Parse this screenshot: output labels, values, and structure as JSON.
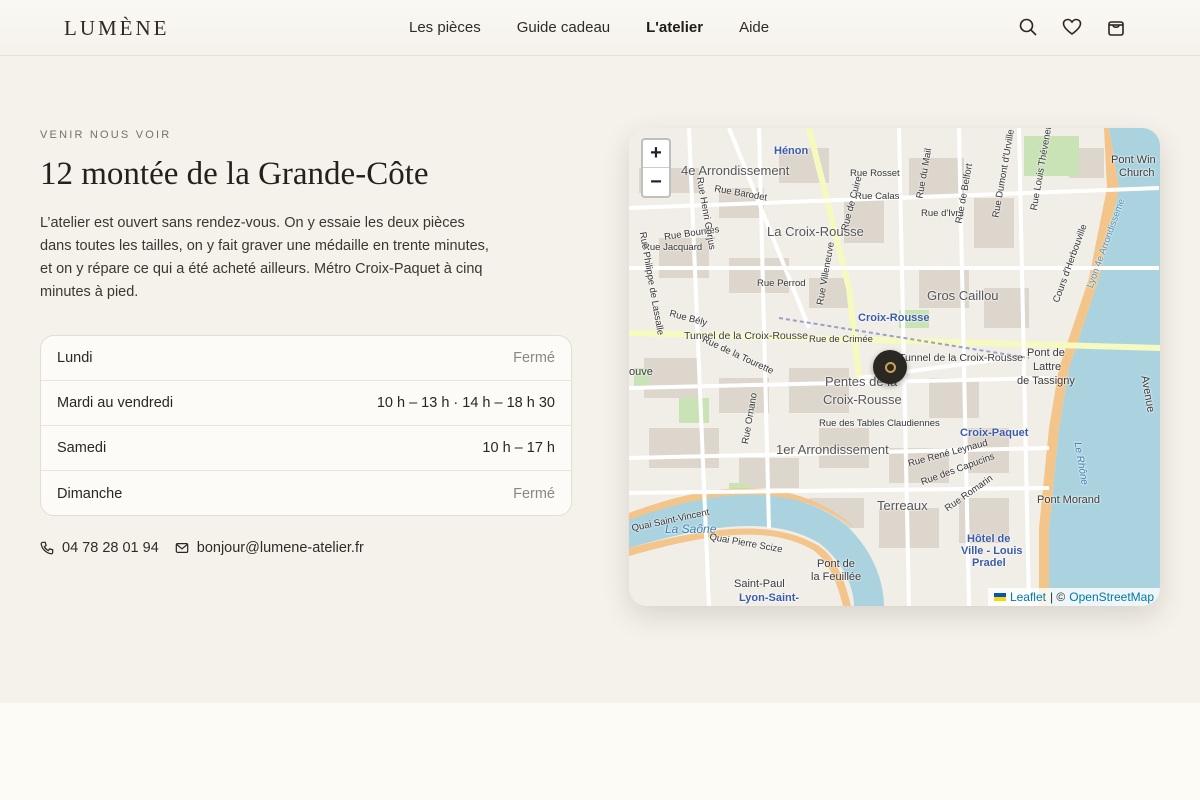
{
  "brand": {
    "logo": "LUMÈNE"
  },
  "nav": {
    "items": [
      {
        "label": "Les pièces",
        "active": false
      },
      {
        "label": "Guide cadeau",
        "active": false
      },
      {
        "label": "L'atelier",
        "active": true
      },
      {
        "label": "Aide",
        "active": false
      }
    ]
  },
  "header_icons": [
    "search-icon",
    "heart-icon",
    "shopping-bag-icon"
  ],
  "visit": {
    "eyebrow": "VENIR NOUS VOIR",
    "title": "12 montée de la Grande-Côte",
    "description": "L’atelier est ouvert sans rendez-vous. On y essaie les deux pièces dans toutes les tailles, on y fait graver une médaille en trente minutes, et on y répare ce qui a été acheté ailleurs. Métro Croix-Paquet à cinq minutes à pied.",
    "hours": [
      {
        "day": "Lundi",
        "time": "Fermé",
        "closed": true
      },
      {
        "day": "Mardi au vendredi",
        "time": "10 h – 13 h · 14 h – 18 h 30",
        "closed": false
      },
      {
        "day": "Samedi",
        "time": "10 h – 17 h",
        "closed": false
      },
      {
        "day": "Dimanche",
        "time": "Fermé",
        "closed": true
      }
    ],
    "phone": "04 78 28 01 94",
    "email": "bonjour@lumene-atelier.fr"
  },
  "map": {
    "zoom_in": "+",
    "zoom_out": "−",
    "attribution_leaflet": "Leaflet",
    "attribution_sep": "| ©",
    "attribution_osm": "OpenStreetMap",
    "labels": {
      "henon": "Hénon",
      "arr4": "4e Arrondissement",
      "croix_rousse": "La Croix-Rousse",
      "gros_caillou": "Gros Caillou",
      "station_croix_rousse": "Croix-Rousse",
      "tunnel": "Tunnel de la Croix-Rousse",
      "pentes1": "Pentes de la",
      "pentes2": "Croix-Rousse",
      "arr1": "1er Arrondissement",
      "croix_paquet": "Croix-Paquet",
      "terreaux": "Terreaux",
      "pont_morand": "Pont Morand",
      "lattre1": "Pont de",
      "lattre2": "Lattre",
      "lattre3": "de Tassigny",
      "hdv1": "Hôtel de",
      "hdv2": "Ville - Louis",
      "hdv3": "Pradel",
      "saone": "La Saône",
      "rhone": "Le Rhône",
      "saint_paul": "Saint-Paul",
      "lyon_saint": "Lyon-Saint-",
      "pont_feuillee1": "Pont de",
      "pont_feuillee2": "la Feuillée",
      "pont_winston1": "Pont Win",
      "pont_winston2": "Church",
      "rue_rosset": "Rue Rosset",
      "rue_calas": "Rue Calas",
      "rue_barodet": "Rue Barodet",
      "rue_bournes": "Rue Bournes",
      "rue_jacquard": "Rue Jacquard",
      "rue_perrod": "Rue Perrod",
      "rue_bely": "Rue Bély",
      "rue_crimee": "Rue de Crimée",
      "rue_tourette": "Rue de la Tourette",
      "rue_tables": "Rue des Tables Claudiennes",
      "rue_leynaud": "Rue René Leynaud",
      "rue_capucins": "Rue des Capucins",
      "rue_romarin": "Rue Romarin",
      "rue_ivry": "Rue d'Ivry",
      "quai_scize": "Quai Pierre Scize",
      "quai_vincent": "Quai Saint-Vincent",
      "cours_herbouville": "Cours d'Herbouville",
      "lyon_arr": "Lyon 4e Arrondisseme",
      "rue_ornano": "Rue Ornano",
      "rue_goujon": "Rue Henri Gorjus",
      "rue_lassalle": "Rue Philippe de Lassalle",
      "rue_villeneuve": "Rue Villeneuve",
      "rue_belfort": "Rue de Belfort",
      "rue_dumont": "Rue Dumont d'Urville",
      "rue_mail": "Rue du Mail",
      "rue_curie": "Rue de Cuire",
      "rue_thevenet": "Rue Louis Thévenet",
      "tunnel2": "Tunnel de la Croix-Rousse",
      "ouve": "ouve",
      "avenue": "Avenue"
    }
  }
}
